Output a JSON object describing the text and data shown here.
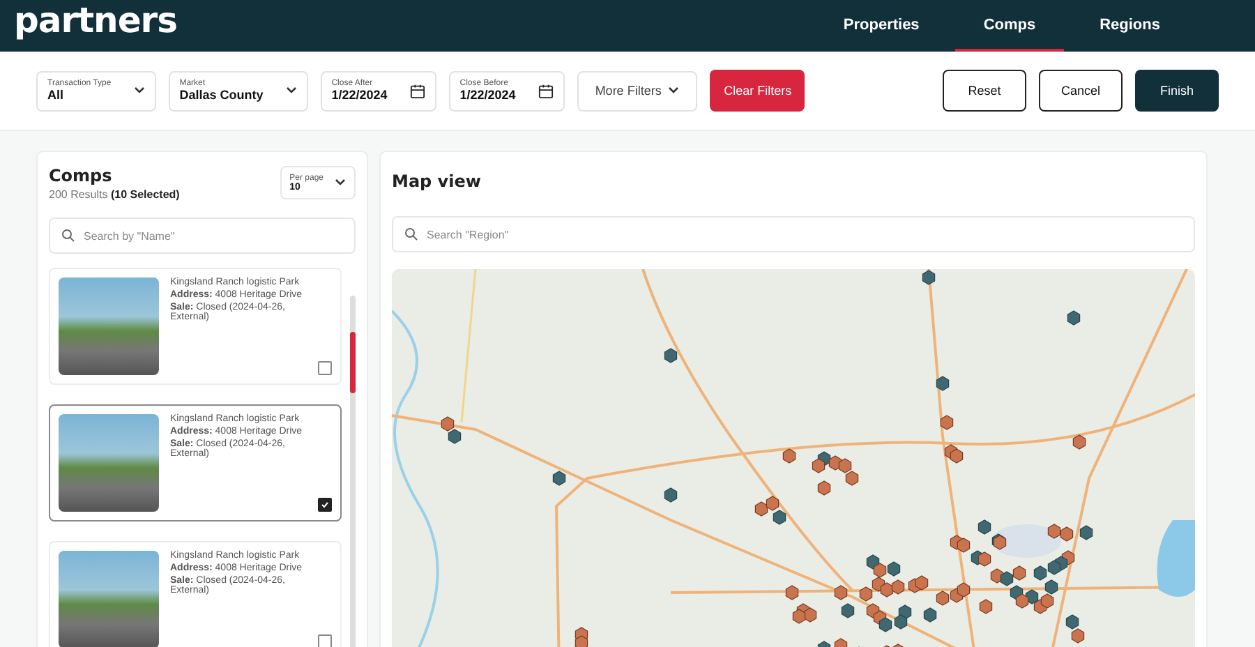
{
  "header": {
    "logo": "partners",
    "nav": [
      {
        "label": "Properties",
        "selected": false
      },
      {
        "label": "Comps",
        "selected": true
      },
      {
        "label": "Regions",
        "selected": false
      }
    ]
  },
  "filters": [
    {
      "kind": "select",
      "label": "Transaction Type",
      "value": "All"
    },
    {
      "kind": "select",
      "label": "Market",
      "value": "Dallas County"
    },
    {
      "kind": "date",
      "label": "Close After",
      "value": "1/22/2024"
    },
    {
      "kind": "date",
      "label": "Close Before",
      "value": "1/22/2024"
    },
    {
      "kind": "menu",
      "value": "More Filters"
    },
    {
      "kind": "danger",
      "value": "Clear Filters"
    }
  ],
  "actions": [
    {
      "kind": "outline",
      "label": "Reset"
    },
    {
      "kind": "outline",
      "label": "Cancel"
    },
    {
      "kind": "primary",
      "label": "Finish"
    }
  ],
  "comps": {
    "title": "Comps",
    "results": "200 Results",
    "selected_count": "(10 Selected)",
    "per_page": {
      "label": "Per page",
      "value": "10"
    },
    "search": {
      "placeholder": "Search by \"Name\""
    },
    "items": [
      {
        "title": "Kingsland Ranch logistic Park",
        "address": "**Address:** 4008 Heritage Drive",
        "sale": "**Sale:** Closed (2024-04-26, External)",
        "checked": false,
        "selected": false
      },
      {
        "title": "Kingsland Ranch logistic Park",
        "address": "**Address:** 4008 Heritage Drive",
        "sale": "**Sale:** Closed (2024-04-26, External)",
        "checked": true,
        "selected": true
      },
      {
        "title": "Kingsland Ranch logistic Park",
        "address": "**Address:** 4008 Heritage Drive",
        "sale": "**Sale:** Closed (2024-04-26, External)",
        "checked": false,
        "selected": false
      }
    ]
  },
  "map": {
    "title": "Map view",
    "search": {
      "placeholder": "Search \"Region\""
    }
  }
}
